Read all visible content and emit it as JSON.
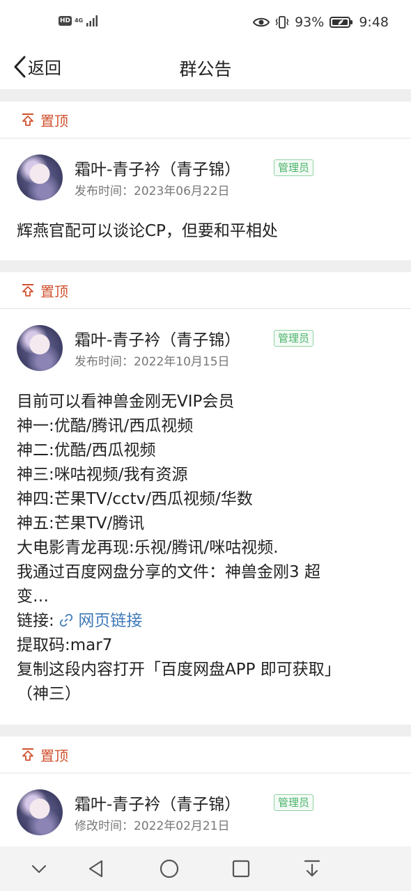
{
  "status_bar": {
    "hd": "HD",
    "network": "4G",
    "battery": "93%",
    "time": "9:48"
  },
  "nav": {
    "back_label": "返回",
    "title": "群公告"
  },
  "posts": [
    {
      "pin_label": "置顶",
      "author": "霜叶-青子衿（青子锦）",
      "role": "管理员",
      "time": "发布时间：2023年06月22日",
      "lines": [
        "辉燕官配可以谈论CP，但要和平相处"
      ]
    },
    {
      "pin_label": "置顶",
      "author": "霜叶-青子衿（青子锦）",
      "role": "管理员",
      "time": "发布时间：2022年10月15日",
      "lines": [
        "目前可以看神兽金刚无VIP会员",
        "神一:优酷/腾讯/西瓜视频",
        "神二:优酷/西瓜视频",
        "神三:咪咕视频/我有资源",
        "神四:芒果TV/cctv/西瓜视频/华数",
        "神五:芒果TV/腾讯",
        "大电影青龙再现:乐视/腾讯/咪咕视频.",
        "我通过百度网盘分享的文件：神兽金刚3 超",
        "变…"
      ],
      "link_prefix": "链接: ",
      "link_text": "网页链接",
      "lines_after": [
        "提取码:mar7",
        "复制这段内容打开「百度网盘APP 即可获取」",
        "（神三）"
      ]
    },
    {
      "pin_label": "置顶",
      "author": "霜叶-青子衿（青子锦）",
      "role": "管理员",
      "time": "修改时间：2022年02月21日"
    }
  ],
  "icons": {
    "pin": "pin-top-icon",
    "back": "chevron-left-icon",
    "link": "link-icon",
    "eye": "eye-icon",
    "vibrate": "vibrate-icon",
    "battery": "battery-icon",
    "signal": "signal-icon"
  },
  "colors": {
    "accent_pin": "#d0522e",
    "admin_badge": "#4bb36b",
    "link": "#3f79b8",
    "separator": "#efefef"
  }
}
